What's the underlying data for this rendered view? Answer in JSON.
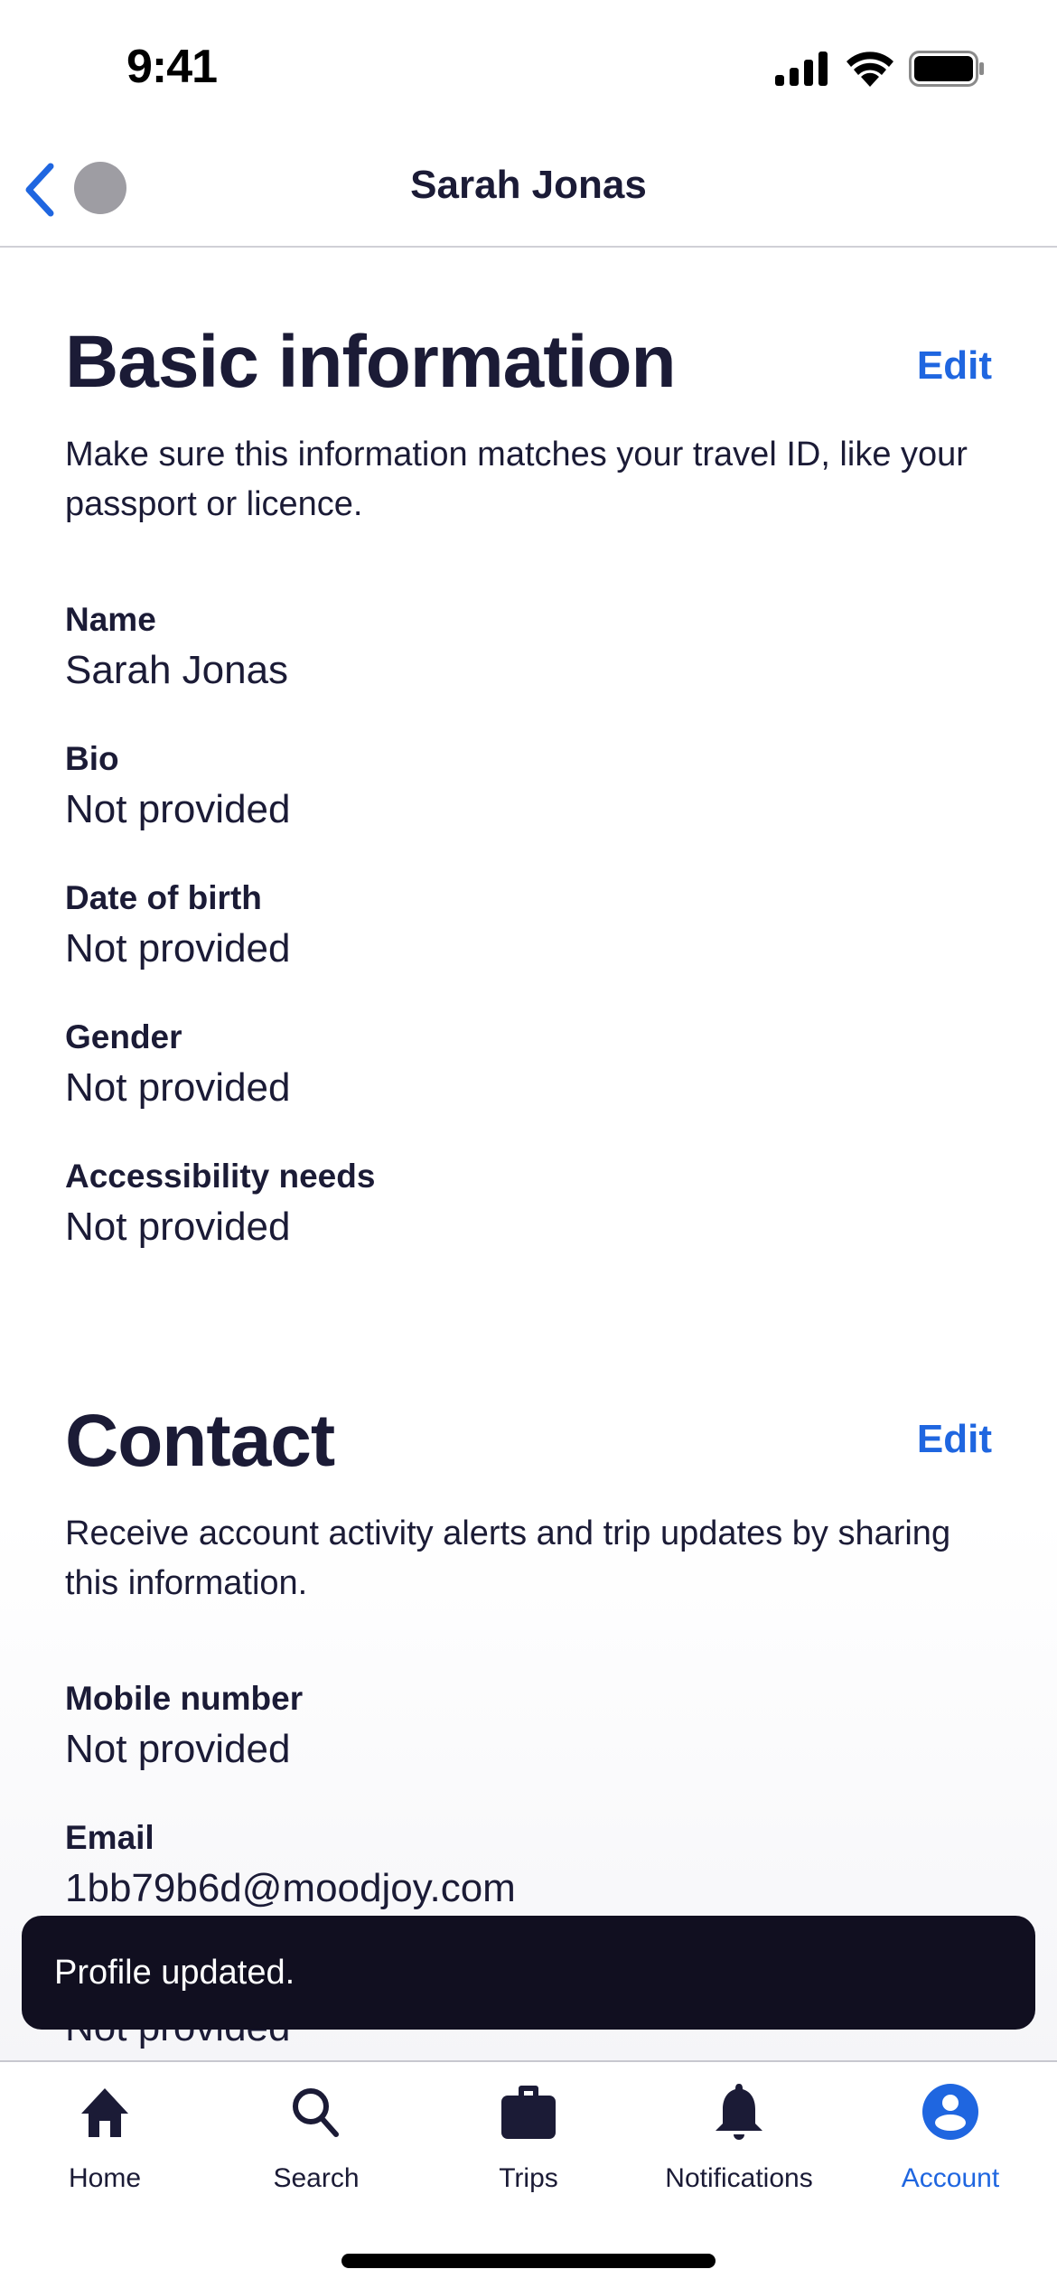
{
  "status_bar": {
    "time": "9:41",
    "icons": [
      "cellular-signal-icon",
      "wifi-icon",
      "battery-icon"
    ]
  },
  "header": {
    "title": "Sarah Jonas",
    "back_icon": "chevron-left-icon",
    "avatar_color": "#9e9da3"
  },
  "basic_info": {
    "title": "Basic information",
    "edit_label": "Edit",
    "description": "Make sure this information matches your travel ID, like your passport or licence.",
    "fields": [
      {
        "label": "Name",
        "value": "Sarah Jonas"
      },
      {
        "label": "Bio",
        "value": "Not provided"
      },
      {
        "label": "Date of birth",
        "value": "Not provided"
      },
      {
        "label": "Gender",
        "value": "Not provided"
      },
      {
        "label": "Accessibility needs",
        "value": "Not provided"
      }
    ]
  },
  "contact": {
    "title": "Contact",
    "edit_label": "Edit",
    "description": "Receive account activity alerts and trip updates by sharing this information.",
    "fields": [
      {
        "label": "Mobile number",
        "value": "Not provided"
      },
      {
        "label": "Email",
        "value": "1bb79b6d@moodjoy.com"
      },
      {
        "label": "",
        "value": "Not provided"
      }
    ]
  },
  "toast": {
    "message": "Profile updated."
  },
  "tab_bar": {
    "active": "Account",
    "accent_color": "#1f66e0",
    "items": [
      {
        "label": "Home",
        "icon": "home-icon"
      },
      {
        "label": "Search",
        "icon": "search-icon"
      },
      {
        "label": "Trips",
        "icon": "briefcase-icon"
      },
      {
        "label": "Notifications",
        "icon": "bell-icon"
      },
      {
        "label": "Account",
        "icon": "account-icon"
      }
    ]
  }
}
